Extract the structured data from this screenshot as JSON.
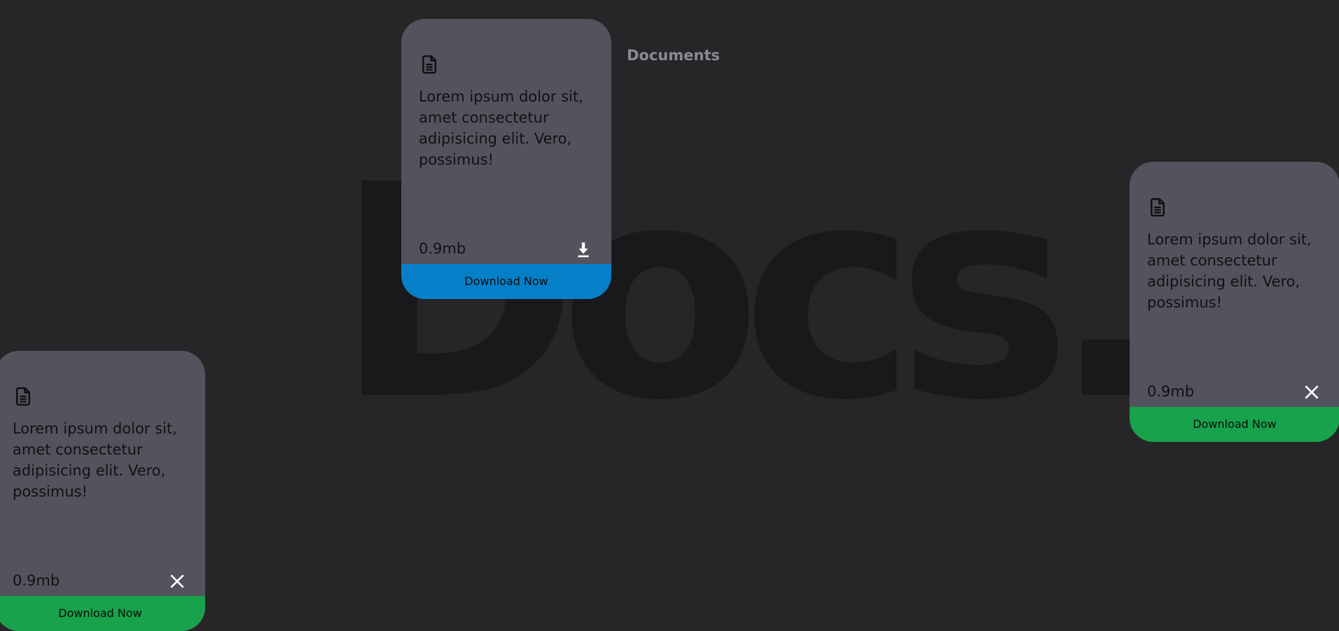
{
  "background_title": "Docs.",
  "section_title": "Documents",
  "colors": {
    "page_background": "#262628",
    "card_background": "#53535d",
    "button_blue": "#0580c8",
    "button_green": "#17a24b"
  },
  "cards": [
    {
      "text": "Lorem ipsum dolor sit, amet consectetur adipisicing elit. Vero, possimus!",
      "size": "0.9mb",
      "action_icon": "download-icon",
      "button_label": "Download Now",
      "button_color": "#0580c8"
    },
    {
      "text": "Lorem ipsum dolor sit, amet consectetur adipisicing elit. Vero, possimus!",
      "size": "0.9mb",
      "action_icon": "close-icon",
      "button_label": "Download Now",
      "button_color": "#17a24b"
    },
    {
      "text": "Lorem ipsum dolor sit, amet consectetur adipisicing elit. Vero, possimus!",
      "size": "0.9mb",
      "action_icon": "close-icon",
      "button_label": "Download Now",
      "button_color": "#17a24b"
    }
  ]
}
